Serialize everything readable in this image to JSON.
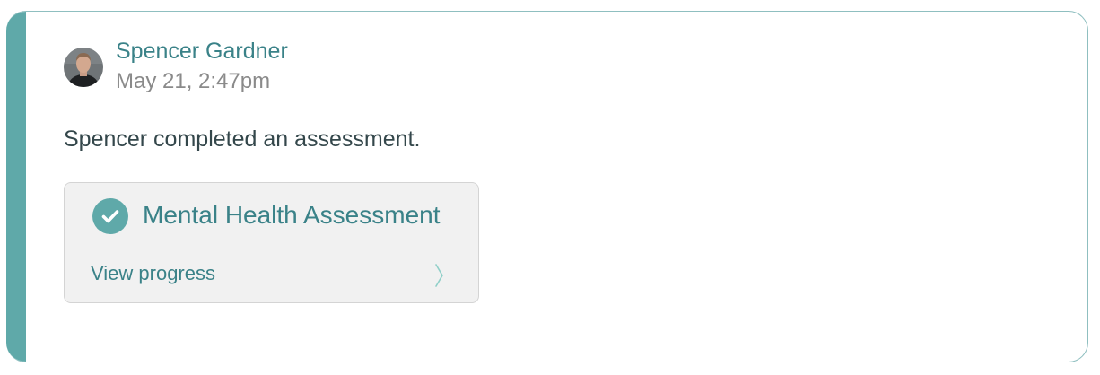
{
  "post": {
    "author_name": "Spencer Gardner",
    "timestamp": "May 21, 2:47pm",
    "activity_text": "Spencer completed an assessment."
  },
  "assessment": {
    "title": "Mental Health Assessment",
    "link_label": "View progress",
    "status_icon": "check-circle-icon",
    "chevron_icon": "chevron-right-icon"
  },
  "colors": {
    "accent": "#5fa9a9",
    "accent_text": "#3a8288",
    "muted_text": "#8a8a8a",
    "body_text": "#34474b",
    "tile_background": "#f1f1f1",
    "card_border": "#8fbfc0"
  }
}
